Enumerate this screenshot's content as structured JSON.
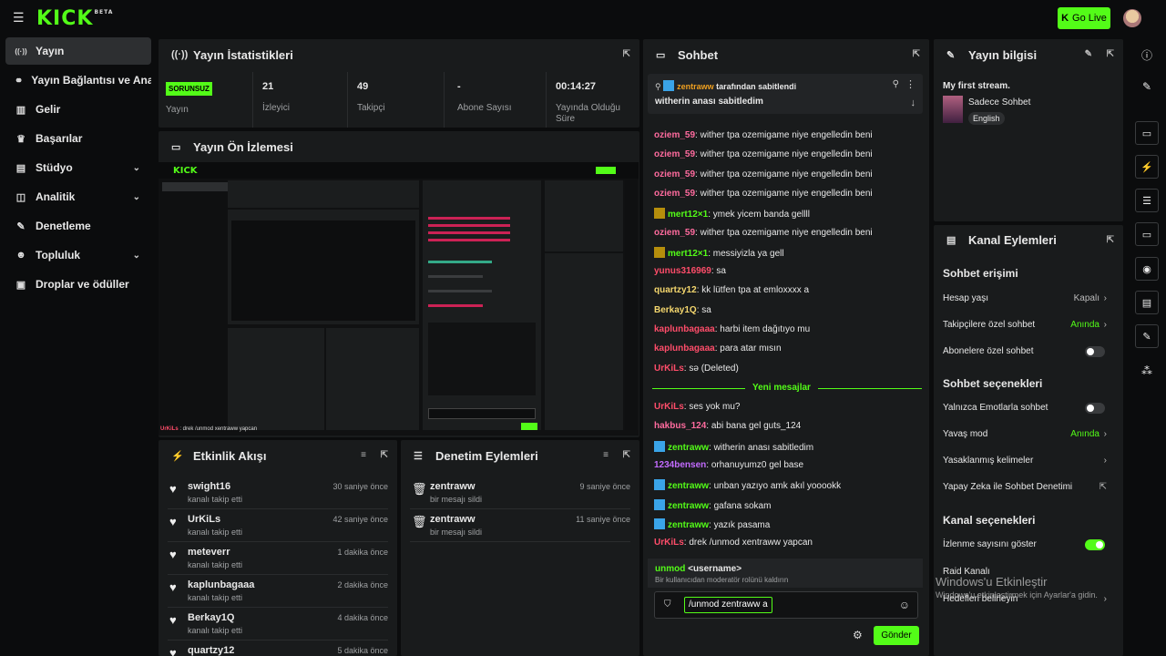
{
  "topbar": {
    "logo": "KICK",
    "logo_beta": "BETA",
    "go_live": "Go Live"
  },
  "sidebar": {
    "items": [
      {
        "label": "Yayın",
        "icon": "broadcast-icon",
        "glyph": "((·))",
        "chevron": false
      },
      {
        "label": "Yayın Bağlantısı ve Anahtarı",
        "icon": "link-icon",
        "glyph": "⚭",
        "chevron": false
      },
      {
        "label": "Gelir",
        "icon": "chart-icon",
        "glyph": "▥",
        "chevron": false
      },
      {
        "label": "Başarılar",
        "icon": "trophy-icon",
        "glyph": "♛",
        "chevron": false
      },
      {
        "label": "Stüdyo",
        "icon": "studio-icon",
        "glyph": "▤",
        "chevron": true
      },
      {
        "label": "Analitik",
        "icon": "analytics-icon",
        "glyph": "◫",
        "chevron": true
      },
      {
        "label": "Denetleme",
        "icon": "wrench-icon",
        "glyph": "✎",
        "chevron": false
      },
      {
        "label": "Topluluk",
        "icon": "community-icon",
        "glyph": "☻",
        "chevron": true
      },
      {
        "label": "Droplar ve ödüller",
        "icon": "gift-icon",
        "glyph": "▣",
        "chevron": false
      }
    ]
  },
  "stats": {
    "title": "Yayın İstatistikleri",
    "items": [
      {
        "value": "SORUNSUZ",
        "label": "Yayın"
      },
      {
        "value": "21",
        "label": "İzleyici"
      },
      {
        "value": "49",
        "label": "Takipçi"
      },
      {
        "value": "-",
        "label": "Abone Sayısı"
      },
      {
        "value": "00:14:27",
        "label": "Yayında Olduğu Süre"
      }
    ]
  },
  "preview": {
    "title": "Yayın Ön İzlemesi",
    "overlay_user": "UrKiLs",
    "overlay_text": " : drek /unmod xentraww yapcan"
  },
  "activity": {
    "title": "Etkinlik Akışı",
    "rows": [
      {
        "name": "swight16",
        "sub": "kanalı takip etti",
        "time": "30 saniye önce"
      },
      {
        "name": "UrKiLs",
        "sub": "kanalı takip etti",
        "time": "42 saniye önce"
      },
      {
        "name": "meteverr",
        "sub": "kanalı takip etti",
        "time": "1 dakika önce"
      },
      {
        "name": "kaplunbagaaa",
        "sub": "kanalı takip etti",
        "time": "2 dakika önce"
      },
      {
        "name": "Berkay1Q",
        "sub": "kanalı takip etti",
        "time": "4 dakika önce"
      },
      {
        "name": "quartzy12",
        "sub": "",
        "time": "5 dakika önce"
      }
    ]
  },
  "modactions": {
    "title": "Denetim Eylemleri",
    "rows": [
      {
        "name": "zentraww",
        "sub": "bir mesajı sildi",
        "time": "9 saniye önce"
      },
      {
        "name": "zentraww",
        "sub": "bir mesajı sildi",
        "time": "11 saniye önce"
      }
    ]
  },
  "chat": {
    "title": "Sohbet",
    "pinned_by": "zentraww",
    "pinned_suffix": "tarafından sabitlendi",
    "pinned_text": "witherin anası sabitledim",
    "messages": [
      {
        "user": "oziem_59",
        "color": "#ff6b9e",
        "badge": "",
        "text": "wither tpa ozemigame niye engelledin beni"
      },
      {
        "user": "oziem_59",
        "color": "#ff6b9e",
        "badge": "",
        "text": "wither tpa ozemigame niye engelledin beni"
      },
      {
        "user": "oziem_59",
        "color": "#ff6b9e",
        "badge": "",
        "text": "wither tpa ozemigame niye engelledin beni"
      },
      {
        "user": "oziem_59",
        "color": "#ff6b9e",
        "badge": "",
        "text": "wither tpa ozemigame niye engelledin beni"
      },
      {
        "user": "mert12×1",
        "color": "#53fc18",
        "badge": "sub",
        "text": "ymek yicem banda gellll"
      },
      {
        "user": "oziem_59",
        "color": "#ff6b9e",
        "badge": "",
        "text": "wither tpa ozemigame niye engelledin beni"
      },
      {
        "user": "mert12×1",
        "color": "#53fc18",
        "badge": "sub",
        "text": "messiyizla ya gell"
      },
      {
        "user": "yunus316969",
        "color": "#ff4d6a",
        "badge": "",
        "text": "sa"
      },
      {
        "user": "quartzy12",
        "color": "#f5d76e",
        "badge": "",
        "text": "kk lütfen tpa at emloxxxx a"
      },
      {
        "user": "Berkay1Q",
        "color": "#f5d76e",
        "badge": "",
        "text": "sa"
      },
      {
        "user": "kaplunbagaaa",
        "color": "#ff4d6a",
        "badge": "",
        "text": "harbi item dağıtıyo mu"
      },
      {
        "user": "kaplunbagaaa",
        "color": "#ff4d6a",
        "badge": "",
        "text": "para atar mısın"
      },
      {
        "user": "UrKiLs",
        "color": "#ff4d6a",
        "badge": "",
        "text": "sə (Deleted)"
      }
    ],
    "new_messages_label": "Yeni mesajlar",
    "messages2": [
      {
        "user": "UrKiLs",
        "color": "#ff4d6a",
        "badge": "",
        "text": "ses yok mu?"
      },
      {
        "user": "hakbus_124",
        "color": "#ff6b9e",
        "badge": "",
        "text": "abi bana gel guts_124"
      },
      {
        "user": "zentraww",
        "color": "#53fc18",
        "badge": "kick",
        "text": "witherin anası sabitledim"
      },
      {
        "user": "1234bensen",
        "color": "#c36bff",
        "badge": "",
        "text": "orhanuyumz0 gel base"
      },
      {
        "user": "zentraww",
        "color": "#53fc18",
        "badge": "kick",
        "text": "unban yazıyo amk akıl yooookk"
      },
      {
        "user": "zentraww",
        "color": "#53fc18",
        "badge": "kick",
        "text": "gafana sokam"
      },
      {
        "user": "zentraww",
        "color": "#53fc18",
        "badge": "kick",
        "text": "yazık pasama"
      },
      {
        "user": "UrKiLs",
        "color": "#ff4d6a",
        "badge": "",
        "text": "drek /unmod xentraww yapcan"
      }
    ],
    "suggest_cmd": "unmod",
    "suggest_arg": "<username>",
    "suggest_desc": "Bir kullanıcıdan moderatör rolünü kaldırın",
    "input_value": "/unmod zentraww a",
    "send_label": "Gönder"
  },
  "info": {
    "title": "Yayın bilgisi",
    "stream_title": "My first stream.",
    "category": "Sadece Sohbet",
    "language": "English"
  },
  "channel": {
    "title": "Kanal Eylemleri",
    "chat_access_title": "Sohbet erişimi",
    "account_age_label": "Hesap yaşı",
    "account_age_value": "Kapalı",
    "followers_only_label": "Takipçilere özel sohbet",
    "followers_only_value": "Anında",
    "subs_only_label": "Abonelere özel sohbet",
    "chat_options_title": "Sohbet seçenekleri",
    "emotes_only_label": "Yalnızca Emotlarla sohbet",
    "slow_mode_label": "Yavaş mod",
    "slow_mode_value": "Anında",
    "banned_words_label": "Yasaklanmış kelimeler",
    "ai_mod_label": "Yapay Zeka ile Sohbet Denetimi",
    "channel_options_title": "Kanal seçenekleri",
    "show_viewers_label": "İzlenme sayısını göster",
    "raid_label": "Raid Kanalı",
    "targets_label": "Hedefleri belirleyin"
  },
  "watermark": {
    "line1": "Windows'u Etkinleştir",
    "line2": "Windows'u etkinleştirmek için Ayarlar'a gidin."
  },
  "colors": {
    "accent": "#53fc18",
    "panel": "#191b1c",
    "bg": "#0b0c0d"
  }
}
